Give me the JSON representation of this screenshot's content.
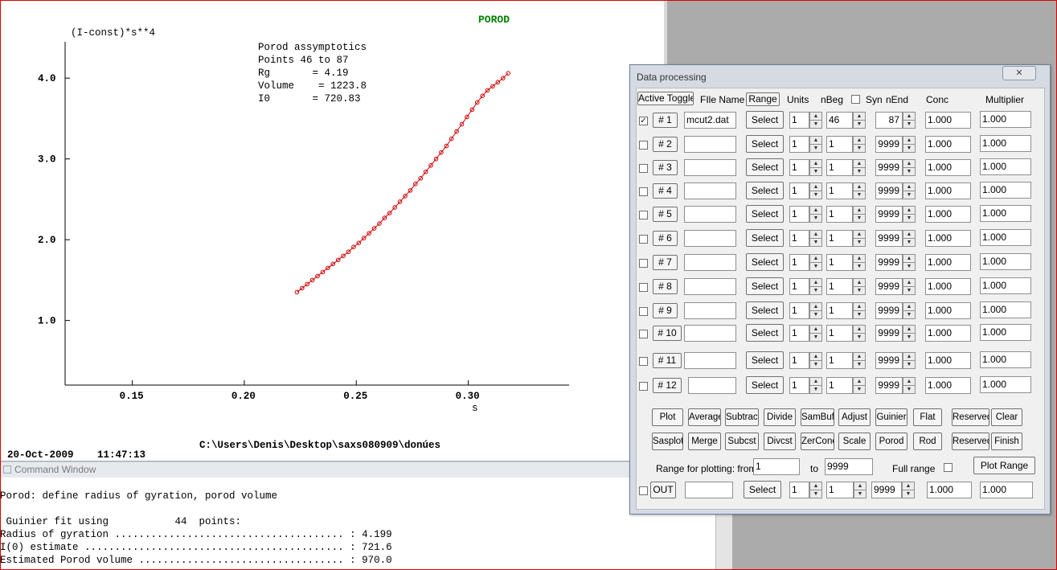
{
  "plot": {
    "title": "POROD",
    "ylabel": "(I-const)*s**4",
    "xlabel": "s",
    "annotations": [
      "Porod assymptotics",
      "Points 46 to 87",
      "Rg       = 4.19",
      "Volume    = 1223.8",
      "I0       = 720.83"
    ],
    "date": "20-Oct-2009",
    "time": "11:47:13",
    "path": "C:\\Users\\Denis\\Desktop\\saxs080909\\donúes"
  },
  "chart_data": {
    "type": "scatter",
    "xlabel": "s",
    "ylabel": "(I-const)*s**4",
    "title": "POROD",
    "xlim": [
      0.12,
      0.345
    ],
    "ylim": [
      0.2,
      4.45
    ],
    "xticks": [
      0.15,
      0.2,
      0.25,
      0.3
    ],
    "xtick_labels": [
      "0.15",
      "0.20",
      "0.25",
      "0.30"
    ],
    "yticks": [
      1.0,
      2.0,
      3.0,
      4.0
    ],
    "ytick_labels": [
      "1.0",
      "2.0",
      "3.0",
      "4.0"
    ],
    "series": [
      {
        "color": "#d00000",
        "x": [
          0.2235,
          0.2258,
          0.2281,
          0.2304,
          0.2327,
          0.235,
          0.2373,
          0.2396,
          0.2419,
          0.2442,
          0.2465,
          0.2488,
          0.2511,
          0.2534,
          0.2557,
          0.258,
          0.2603,
          0.2626,
          0.2649,
          0.2672,
          0.2695,
          0.2718,
          0.2741,
          0.2764,
          0.2787,
          0.281,
          0.2833,
          0.2856,
          0.2879,
          0.2902,
          0.2925,
          0.2948,
          0.2971,
          0.2994,
          0.3017,
          0.304,
          0.3063,
          0.3086,
          0.3109,
          0.3132,
          0.3155,
          0.3178
        ],
        "y": [
          1.35,
          1.4,
          1.45,
          1.5,
          1.55,
          1.6,
          1.65,
          1.7,
          1.75,
          1.8,
          1.85,
          1.91,
          1.96,
          2.02,
          2.08,
          2.14,
          2.2,
          2.27,
          2.33,
          2.4,
          2.47,
          2.54,
          2.61,
          2.69,
          2.76,
          2.84,
          2.92,
          3.0,
          3.08,
          3.16,
          3.25,
          3.34,
          3.43,
          3.52,
          3.61,
          3.7,
          3.78,
          3.85,
          3.9,
          3.95,
          4.0,
          4.06
        ]
      }
    ]
  },
  "command_window": {
    "title": "Command Window",
    "lines": [
      "Porod: define radius of gyration, porod volume",
      " Guinier fit using           44  points:",
      "Radius of gyration ...................................... : 4.199",
      "I(0) estimate ........................................... : 721.6",
      "Estimated Porod volume .................................. : 970.0"
    ]
  },
  "dialog": {
    "title": "Data processing",
    "close_glyph": "✕",
    "headers": {
      "active_toggle": "Active Toggle",
      "file_name": "FIle Name",
      "range": "Range",
      "units": "Units",
      "nbeg": "nBeg",
      "syn": "Syn",
      "nend": "nEnd",
      "conc": "Conc",
      "multiplier": "Multiplier"
    },
    "rows": [
      {
        "label": "# 1",
        "checked": "✓",
        "file": "mcut2.dat",
        "select": "Select",
        "units": "1",
        "nbeg": "46",
        "nend": "87",
        "conc": "1.000",
        "mult": "1.000"
      },
      {
        "label": "# 2",
        "checked": "",
        "file": "",
        "select": "Select",
        "units": "1",
        "nbeg": "1",
        "nend": "9999",
        "conc": "1.000",
        "mult": "1.000"
      },
      {
        "label": "# 3",
        "checked": "",
        "file": "",
        "select": "Select",
        "units": "1",
        "nbeg": "1",
        "nend": "9999",
        "conc": "1.000",
        "mult": "1.000"
      },
      {
        "label": "# 4",
        "checked": "",
        "file": "",
        "select": "Select",
        "units": "1",
        "nbeg": "1",
        "nend": "9999",
        "conc": "1.000",
        "mult": "1.000"
      },
      {
        "label": "# 5",
        "checked": "",
        "file": "",
        "select": "Select",
        "units": "1",
        "nbeg": "1",
        "nend": "9999",
        "conc": "1.000",
        "mult": "1.000"
      },
      {
        "label": "# 6",
        "checked": "",
        "file": "",
        "select": "Select",
        "units": "1",
        "nbeg": "1",
        "nend": "9999",
        "conc": "1.000",
        "mult": "1.000"
      },
      {
        "label": "# 7",
        "checked": "",
        "file": "",
        "select": "Select",
        "units": "1",
        "nbeg": "1",
        "nend": "9999",
        "conc": "1.000",
        "mult": "1.000"
      },
      {
        "label": "# 8",
        "checked": "",
        "file": "",
        "select": "Select",
        "units": "1",
        "nbeg": "1",
        "nend": "9999",
        "conc": "1.000",
        "mult": "1.000"
      },
      {
        "label": "# 9",
        "checked": "",
        "file": "",
        "select": "Select",
        "units": "1",
        "nbeg": "1",
        "nend": "9999",
        "conc": "1.000",
        "mult": "1.000"
      },
      {
        "label": "# 10",
        "checked": "",
        "file": "",
        "select": "Select",
        "units": "1",
        "nbeg": "1",
        "nend": "9999",
        "conc": "1.000",
        "mult": "1.000"
      },
      {
        "label": "# 11",
        "checked": "",
        "file": "",
        "select": "Select",
        "units": "1",
        "nbeg": "1",
        "nend": "9999",
        "conc": "1.000",
        "mult": "1.000"
      },
      {
        "label": "# 12",
        "checked": "",
        "file": "",
        "select": "Select",
        "units": "1",
        "nbeg": "1",
        "nend": "9999",
        "conc": "1.000",
        "mult": "1.000"
      }
    ],
    "buttons_row1": [
      "Plot",
      "Average",
      "Subtract",
      "Divide",
      "SamBuf",
      "Adjust",
      "Guinier",
      "Flat",
      "Reserved",
      "Clear"
    ],
    "buttons_row2": [
      "Sasplot",
      "Merge",
      "Subcst",
      "Divcst",
      "ZerConc",
      "Scale",
      "Porod",
      "Rod",
      "Reserved",
      "Finish"
    ],
    "range_from_label": "Range for plotting: from",
    "range_from": "1",
    "range_to_label": "to",
    "range_to": "9999",
    "full_range_label": "Full range",
    "plot_range": "Plot Range",
    "out": {
      "label": "OUT",
      "file": "",
      "select": "Select",
      "units": "1",
      "nbeg": "1",
      "nend": "9999",
      "conc": "1.000",
      "mult": "1.000"
    }
  }
}
